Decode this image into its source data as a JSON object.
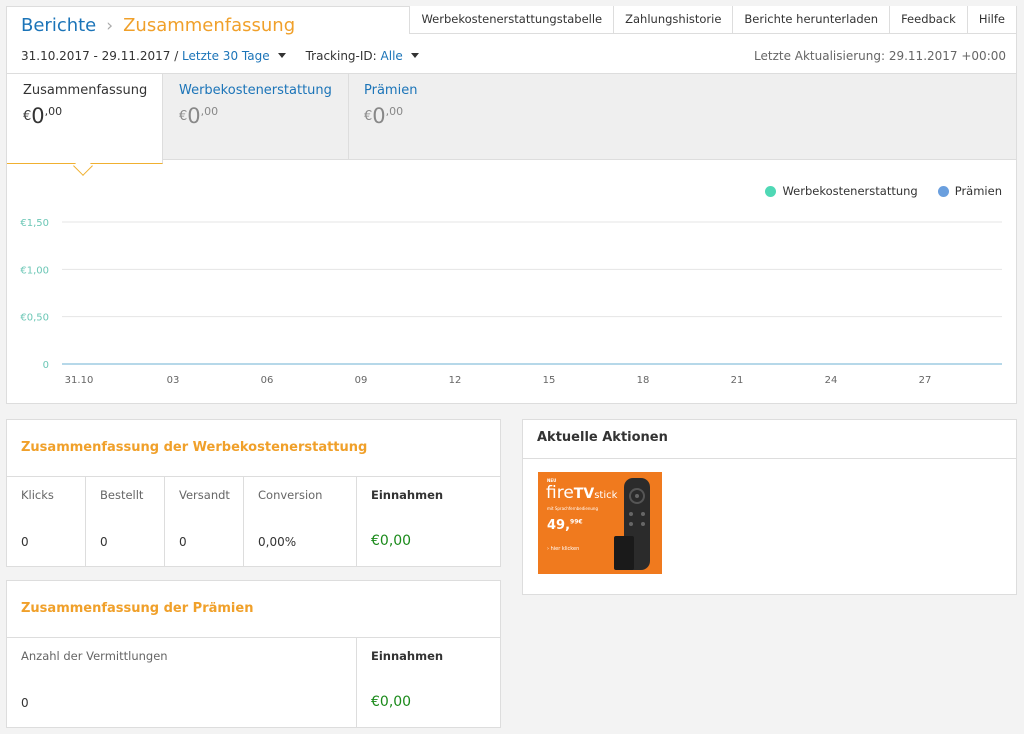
{
  "header": {
    "breadcrumb_root": "Berichte",
    "breadcrumb_sep": "›",
    "breadcrumb_current": "Zusammenfassung"
  },
  "topnav": [
    "Werbekostenerstattungstabelle",
    "Zahlungshistorie",
    "Berichte herunterladen",
    "Feedback",
    "Hilfe"
  ],
  "daterange": {
    "range": "31.10.2017 - 29.11.2017",
    "sep": " / ",
    "preset": "Letzte 30 Tage",
    "tracking_label": "Tracking-ID:",
    "tracking_value": "Alle"
  },
  "last_update": "Letzte Aktualisierung: 29.11.2017 +00:00",
  "tabs": [
    {
      "label": "Zusammenfassung",
      "currency": "€",
      "whole": "0",
      "cents": ",00"
    },
    {
      "label": "Werbekostenerstattung",
      "currency": "€",
      "whole": "0",
      "cents": ",00"
    },
    {
      "label": "Prämien",
      "currency": "€",
      "whole": "0",
      "cents": ",00"
    }
  ],
  "legend": [
    {
      "name": "Werbekostenerstattung",
      "color": "#4fd8b5"
    },
    {
      "name": "Prämien",
      "color": "#6a9fde"
    }
  ],
  "chart_data": {
    "type": "line",
    "x_ticks": [
      "31.10",
      "03",
      "06",
      "09",
      "12",
      "15",
      "18",
      "21",
      "24",
      "27"
    ],
    "y_ticks": [
      "€1,50",
      "€1,00",
      "€0,50",
      "0"
    ],
    "ylim": [
      0,
      1.5
    ],
    "grid": true,
    "legend_position": "top-right",
    "series": [
      {
        "name": "Werbekostenerstattung",
        "values": [
          0,
          0,
          0,
          0,
          0,
          0,
          0,
          0,
          0,
          0
        ]
      },
      {
        "name": "Prämien",
        "values": [
          0,
          0,
          0,
          0,
          0,
          0,
          0,
          0,
          0,
          0
        ]
      }
    ]
  },
  "ad_summary": {
    "title": "Zusammenfassung der Werbekostenerstattung",
    "columns": [
      {
        "head": "Klicks",
        "value": "0"
      },
      {
        "head": "Bestellt",
        "value": "0"
      },
      {
        "head": "Versandt",
        "value": "0"
      },
      {
        "head": "Conversion",
        "value": "0,00%"
      },
      {
        "head": "Einnahmen",
        "value": "€0,00"
      }
    ]
  },
  "bounty_summary": {
    "title": "Zusammenfassung der Prämien",
    "columns": [
      {
        "head": "Anzahl der Vermittlungen",
        "value": "0"
      },
      {
        "head": "Einnahmen",
        "value": "€0,00"
      }
    ]
  },
  "actions": {
    "title": "Aktuelle Aktionen",
    "promo": {
      "brand_small": "NEU",
      "fire": "fire",
      "tv": "TV",
      "stick": "stick",
      "sub": "mit Sprachfernbedienung",
      "price_whole": "49,",
      "price_cents": "99€",
      "cta": "› hier klicken"
    }
  }
}
